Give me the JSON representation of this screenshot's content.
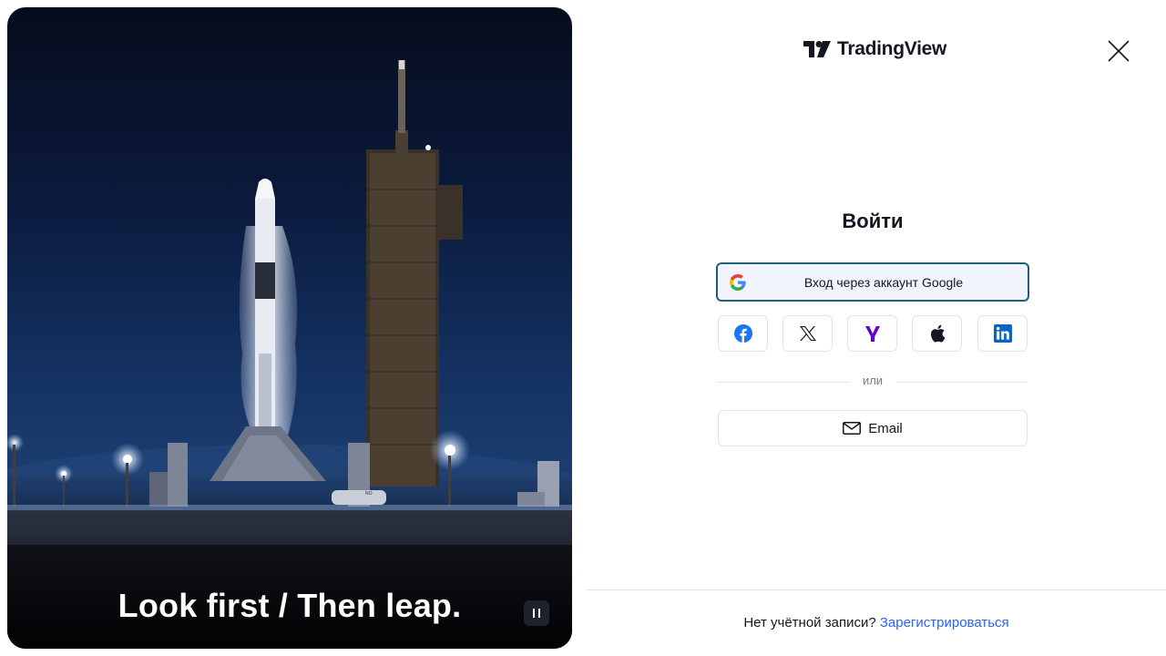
{
  "media": {
    "tagline": "Look first / Then leap.",
    "pause_icon": "pause-icon",
    "vehicle_text": "NO"
  },
  "header": {
    "brand": "TradingView",
    "logo_icon": "tradingview-logo-icon",
    "close_icon": "close-icon"
  },
  "login": {
    "title": "Войти",
    "google_label": "Вход через аккаунт Google",
    "social_icons": [
      "facebook-icon",
      "x-icon",
      "yahoo-icon",
      "apple-icon",
      "linkedin-icon"
    ],
    "divider_text": "или",
    "email_label": "Email"
  },
  "footer": {
    "prompt": "Нет учётной записи?",
    "signup_link": "Зарегистрироваться"
  },
  "colors": {
    "link": "#2962ff",
    "google_border": "#1e5f7a",
    "google_bg": "#f1f5fb",
    "facebook": "#1877f2",
    "yahoo": "#6001d2",
    "linkedin": "#0a66c2"
  }
}
